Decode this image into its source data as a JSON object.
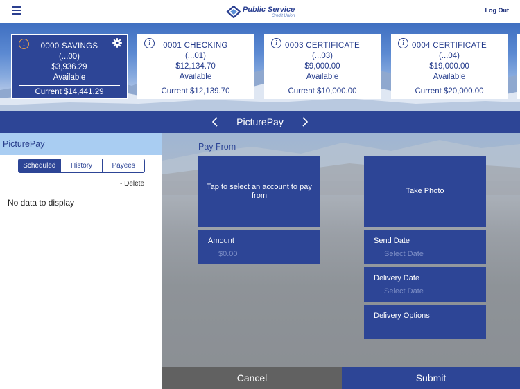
{
  "header": {
    "logo_main": "Public Service",
    "logo_sub": "Credit Union",
    "logout_label": "Log Out"
  },
  "accounts": [
    {
      "name": "0000 SAVINGS",
      "mask": "(...00)",
      "balance": "$3,936.29",
      "status": "Available",
      "current": "Current $14,441.29",
      "selected": true
    },
    {
      "name": "0001 CHECKING",
      "mask": "(...01)",
      "balance": "$12,134.70",
      "status": "Available",
      "current": "Current $12,139.70",
      "selected": false
    },
    {
      "name": "0003 CERTIFICATE",
      "mask": "(...03)",
      "balance": "$9,000.00",
      "status": "Available",
      "current": "Current $10,000.00",
      "selected": false
    },
    {
      "name": "0004 CERTIFICATE",
      "mask": "(...04)",
      "balance": "$19,000.00",
      "status": "Available",
      "current": "Current $20,000.00",
      "selected": false
    }
  ],
  "nav": {
    "title": "PicturePay"
  },
  "left": {
    "title": "PicturePay",
    "tabs": [
      "Scheduled",
      "History",
      "Payees"
    ],
    "active_tab": "Scheduled",
    "delete_label": "- Delete",
    "empty_text": "No data to display"
  },
  "form": {
    "pay_from_label": "Pay From",
    "select_account": "Tap to select an account to pay from",
    "take_photo": "Take Photo",
    "amount_label": "Amount",
    "amount_placeholder": "$0.00",
    "send_date_label": "Send Date",
    "send_date_placeholder": "Select Date",
    "delivery_date_label": "Delivery Date",
    "delivery_date_placeholder": "Select Date",
    "delivery_options_label": "Delivery Options",
    "cancel_label": "Cancel",
    "submit_label": "Submit"
  },
  "colors": {
    "brand": "#2d4596",
    "sidebar_header": "#a9cdf2",
    "cancel_bg": "#616161",
    "info_accent": "#e9a24a"
  },
  "icons": {
    "menu": "hamburger-menu-icon",
    "info": "info-icon",
    "settings": "gear-icon",
    "prev": "chevron-left-icon",
    "next": "chevron-right-icon"
  }
}
